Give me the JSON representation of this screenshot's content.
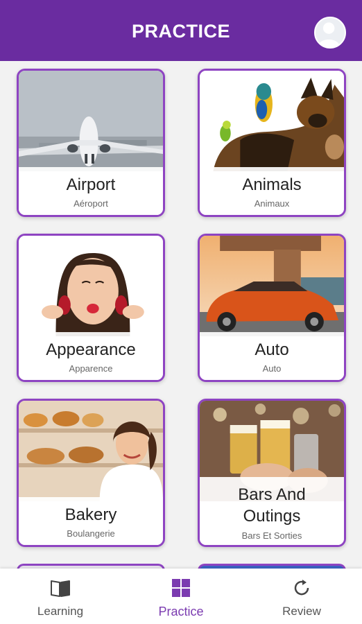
{
  "header": {
    "title": "PRACTICE"
  },
  "categories": [
    {
      "title": "Airport",
      "subtitle": "Aéroport"
    },
    {
      "title": "Animals",
      "subtitle": "Animaux"
    },
    {
      "title": "Appearance",
      "subtitle": "Apparence"
    },
    {
      "title": "Auto",
      "subtitle": "Auto"
    },
    {
      "title": "Bakery",
      "subtitle": "Boulangerie"
    },
    {
      "title_line1": "Bars And",
      "title_line2": "Outings",
      "subtitle": "Bars Et Sorties"
    }
  ],
  "nav": {
    "learning": "Learning",
    "practice": "Practice",
    "review": "Review"
  },
  "colors": {
    "header": "#6a2ca0",
    "card_border": "#8e44c2",
    "active_nav": "#7b3bb0"
  },
  "icons": [
    "user-avatar-icon",
    "book-icon",
    "grid-icon",
    "refresh-icon"
  ]
}
